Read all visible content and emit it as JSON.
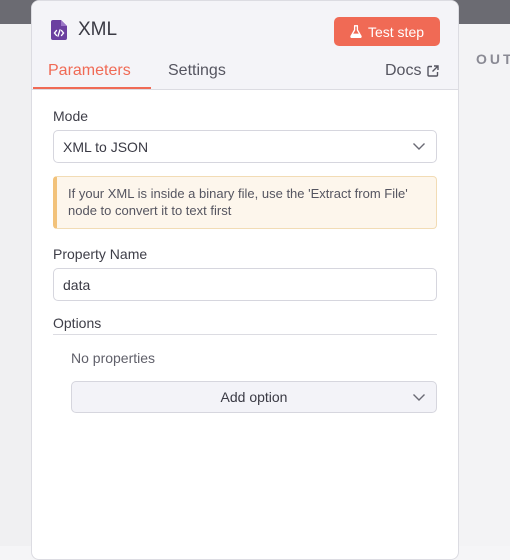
{
  "node": {
    "title": "XML",
    "icon": "file-code-icon",
    "test_button_label": "Test step",
    "test_button_icon": "flask-icon",
    "accent_color": "#f06a55",
    "icon_color": "#6b3fa0"
  },
  "tabs": [
    {
      "label": "Parameters",
      "active": true
    },
    {
      "label": "Settings",
      "active": false
    }
  ],
  "docs": {
    "label": "Docs",
    "icon": "external-link-icon"
  },
  "output_panel": {
    "label": "OUT"
  },
  "mode": {
    "label": "Mode",
    "value": "XML to JSON"
  },
  "notice": {
    "text": "If your XML is inside a binary file, use the 'Extract from File' node to convert it to text first"
  },
  "property_name": {
    "label": "Property Name",
    "value": "data"
  },
  "options": {
    "label": "Options",
    "empty_text": "No properties",
    "add_label": "Add option"
  }
}
